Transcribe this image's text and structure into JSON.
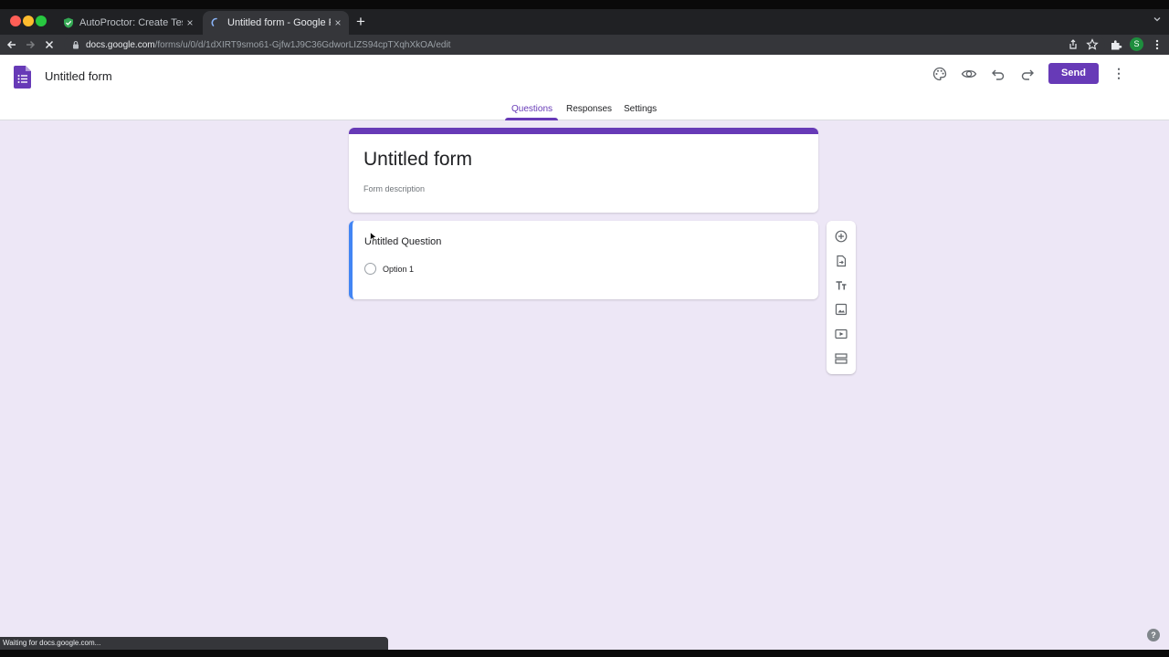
{
  "browser": {
    "tabs": [
      {
        "title": "AutoProctor: Create Test",
        "favicon": "shield-icon",
        "active": false
      },
      {
        "title": "Untitled form - Google Forms",
        "favicon": "loading-spinner-icon",
        "active": true
      }
    ],
    "close_glyph": "×",
    "new_tab_glyph": "+",
    "url_host": "docs.google.com",
    "url_path": "/forms/u/0/d/1dXIRT9smo61-Gjfw1J9C36GdworLIZS94cpTXqhXkOA/edit",
    "profile_initial": "S",
    "status_text": "Waiting for docs.google.com..."
  },
  "app": {
    "doc_title": "Untitled form",
    "send_label": "Send",
    "more_glyph": "⋮",
    "accent_color": "#673ab7",
    "tabs": {
      "questions": "Questions",
      "responses": "Responses",
      "settings": "Settings"
    },
    "active_tab": "Questions"
  },
  "form": {
    "title": "Untitled form",
    "description_placeholder": "Form description",
    "question": {
      "title": "Untitled Question",
      "options": [
        "Option 1"
      ]
    }
  },
  "side_toolbar": [
    "add-question-icon",
    "import-questions-icon",
    "add-title-icon",
    "add-image-icon",
    "add-video-icon",
    "add-section-icon"
  ],
  "help_glyph": "?"
}
